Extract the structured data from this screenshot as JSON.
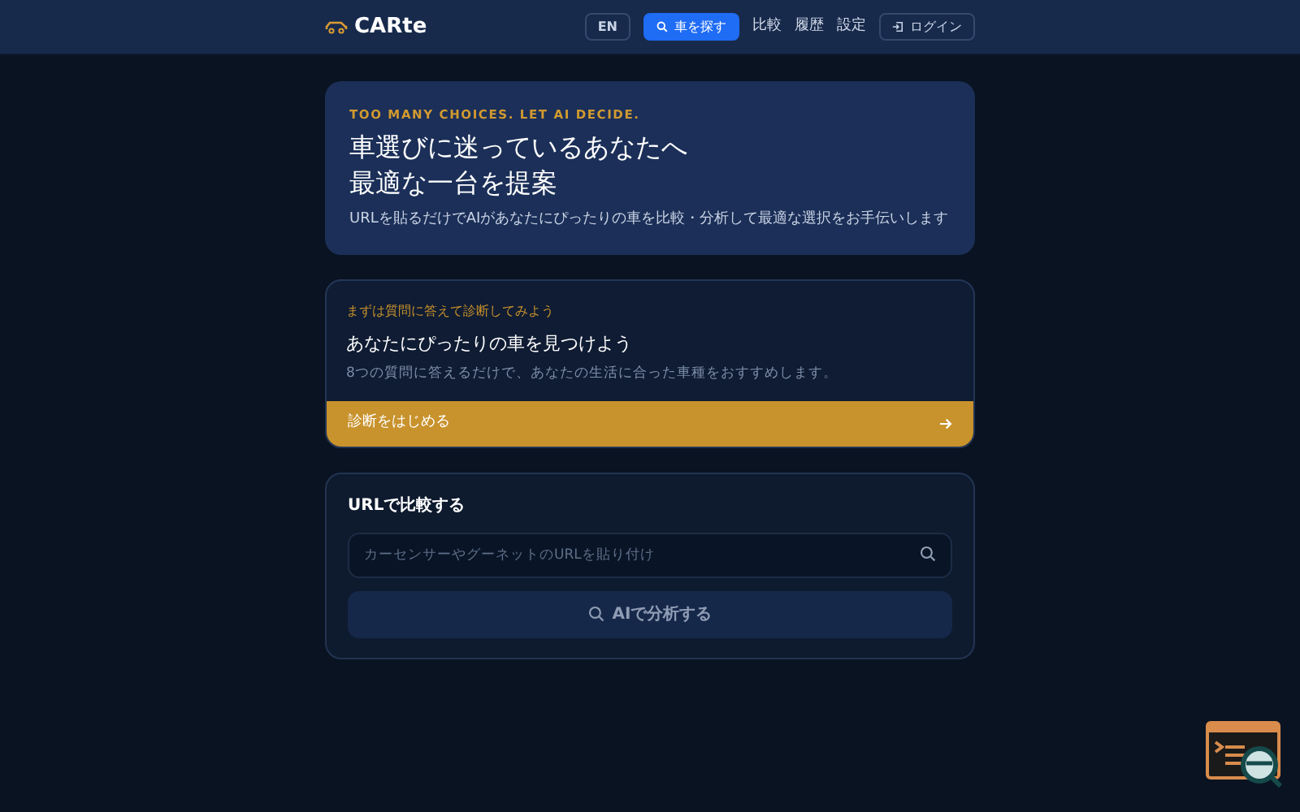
{
  "navbar": {
    "brand": "CARte",
    "lang_button": "EN",
    "search_button": "車を探す",
    "links": [
      "比較",
      "履歴",
      "設定"
    ],
    "login_button": "ログイン"
  },
  "hero": {
    "eyebrow": "TOO MANY CHOICES. LET AI DECIDE.",
    "title_lines": [
      "車選びに迷っているあなたへ",
      "最適な一台を提案"
    ],
    "description": "URLを貼るだけでAIがあなたにぴったりの車を比較・分析して最適な選択をお手伝いします"
  },
  "quiz_card": {
    "label": "まずは質問に答えて診断してみよう",
    "title": "あなたにぴったりの車を見つけよう",
    "description": "8つの質問に答えるだけで、あなたの生活に合った車種をおすすめします。",
    "action": "診断をはじめる"
  },
  "url_card": {
    "title": "URLで比較する",
    "placeholder": "カーセンサーやグーネットのURLを貼り付け",
    "submit": "AIで分析する"
  }
}
